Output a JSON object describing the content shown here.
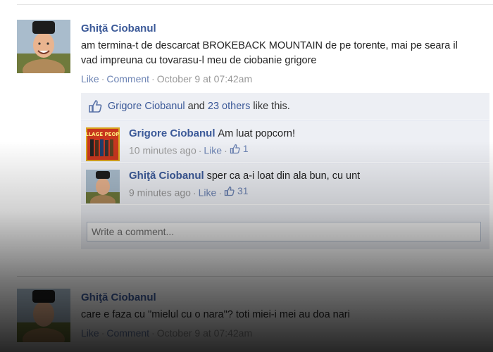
{
  "post1": {
    "author": "Ghiţă Ciobanul",
    "text_line1": "am termina-t de descarcat BROKEBACK MOUNTAIN de pe torente, mai pe seara il",
    "text_line2": "vad impreuna cu tovarasu-l meu de ciobanie grigore",
    "like_label": "Like",
    "comment_label": "Comment",
    "timestamp": "October 9 at 07:42am"
  },
  "likes": {
    "first_name": "Grigore Ciobanul",
    "and": "and",
    "others_link": "23 others",
    "suffix": "like this."
  },
  "comments": [
    {
      "author": "Grigore Ciobanul",
      "text": "Am luat popcorn!",
      "time": "10 minutes ago",
      "like_label": "Like",
      "like_count": "1",
      "avatar_text": "VILLAGE PEOPLE"
    },
    {
      "author": "Ghiţă Ciobanul",
      "text": "sper ca a-i loat din ala bun, cu unt",
      "time": "9 minutes ago",
      "like_label": "Like",
      "like_count": "31"
    }
  ],
  "write_comment_placeholder": "Write a comment...",
  "post2": {
    "author": "Ghiţă Ciobanul",
    "text": "care e faza cu \"mielul cu o nara\"? toti miei-i mei au doa nari",
    "like_label": "Like",
    "comment_label": "Comment",
    "timestamp": "October 9 at 07:42am"
  },
  "colors": {
    "link": "#3b5998",
    "feedback_bg": "#edeff4",
    "muted": "#999999"
  }
}
